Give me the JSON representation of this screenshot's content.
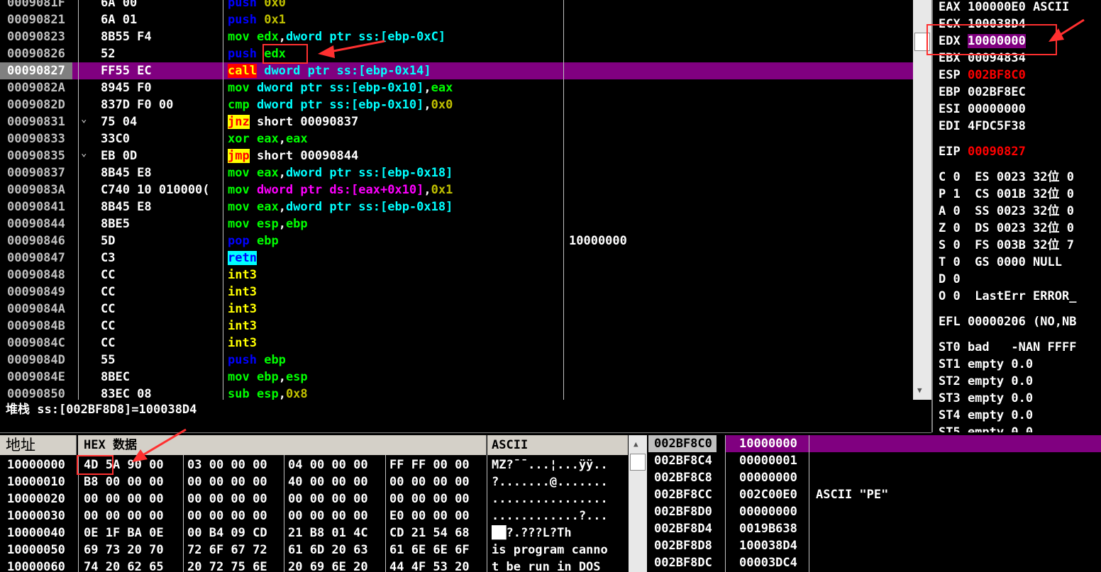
{
  "disasm": {
    "rows": [
      {
        "addr": "0009081F",
        "arrow": "",
        "hex": "6A 00",
        "parts": [
          [
            "push",
            "kw-blue"
          ],
          [
            " ",
            ""
          ],
          [
            "0x0",
            "kw-olive"
          ]
        ]
      },
      {
        "addr": "00090821",
        "arrow": "",
        "hex": "6A 01",
        "parts": [
          [
            "push",
            "kw-blue"
          ],
          [
            " ",
            ""
          ],
          [
            "0x1",
            "kw-olive"
          ]
        ]
      },
      {
        "addr": "00090823",
        "arrow": "",
        "hex": "8B55 F4",
        "parts": [
          [
            "mov",
            "kw-green"
          ],
          [
            " ",
            ""
          ],
          [
            "edx",
            "kw-green"
          ],
          [
            ",",
            ""
          ],
          [
            "dword ptr ss:[ebp-0xC]",
            "kw-cyan"
          ]
        ]
      },
      {
        "addr": "00090826",
        "arrow": "",
        "hex": "52",
        "parts": [
          [
            "push",
            "kw-blue"
          ],
          [
            " ",
            ""
          ],
          [
            "edx",
            "kw-green"
          ]
        ]
      },
      {
        "addr": "00090827",
        "arrow": "",
        "hex": "FF55 EC",
        "parts": [
          [
            "call",
            "kw-redbox"
          ],
          [
            " ",
            ""
          ],
          [
            "dword ptr ss:[ebp-0x14]",
            "kw-cyan"
          ]
        ],
        "selected": true
      },
      {
        "addr": "0009082A",
        "arrow": "",
        "hex": "8945 F0",
        "parts": [
          [
            "mov",
            "kw-green"
          ],
          [
            " ",
            ""
          ],
          [
            "dword ptr ss:[ebp-0x10]",
            "kw-cyan"
          ],
          [
            ",",
            ""
          ],
          [
            "eax",
            "kw-green"
          ]
        ]
      },
      {
        "addr": "0009082D",
        "arrow": "",
        "hex": "837D F0 00",
        "parts": [
          [
            "cmp",
            "kw-green"
          ],
          [
            " ",
            ""
          ],
          [
            "dword ptr ss:[ebp-0x10]",
            "kw-cyan"
          ],
          [
            ",",
            ""
          ],
          [
            "0x0",
            "kw-olive"
          ]
        ]
      },
      {
        "addr": "00090831",
        "arrow": "⌄",
        "hex": "75 04",
        "parts": [
          [
            "jnz",
            "kw-yellowbox"
          ],
          [
            " ",
            ""
          ],
          [
            "short 00090837",
            "white"
          ]
        ]
      },
      {
        "addr": "00090833",
        "arrow": "",
        "hex": "33C0",
        "parts": [
          [
            "xor",
            "kw-green"
          ],
          [
            " ",
            ""
          ],
          [
            "eax",
            "kw-green"
          ],
          [
            ",",
            ""
          ],
          [
            "eax",
            "kw-green"
          ]
        ]
      },
      {
        "addr": "00090835",
        "arrow": "⌄",
        "hex": "EB 0D",
        "parts": [
          [
            "jmp",
            "kw-yellowbox"
          ],
          [
            " ",
            ""
          ],
          [
            "short 00090844",
            "white"
          ]
        ]
      },
      {
        "addr": "00090837",
        "arrow": "",
        "hex": "8B45 E8",
        "parts": [
          [
            "mov",
            "kw-green"
          ],
          [
            " ",
            ""
          ],
          [
            "eax",
            "kw-green"
          ],
          [
            ",",
            ""
          ],
          [
            "dword ptr ss:[ebp-0x18]",
            "kw-cyan"
          ]
        ]
      },
      {
        "addr": "0009083A",
        "arrow": "",
        "hex": "C740 10 010000(",
        "parts": [
          [
            "mov",
            "kw-green"
          ],
          [
            " ",
            ""
          ],
          [
            "dword ptr ds:[eax+0x10]",
            "kw-mag"
          ],
          [
            ",",
            ""
          ],
          [
            "0x1",
            "kw-olive"
          ]
        ]
      },
      {
        "addr": "00090841",
        "arrow": "",
        "hex": "8B45 E8",
        "parts": [
          [
            "mov",
            "kw-green"
          ],
          [
            " ",
            ""
          ],
          [
            "eax",
            "kw-green"
          ],
          [
            ",",
            ""
          ],
          [
            "dword ptr ss:[ebp-0x18]",
            "kw-cyan"
          ]
        ]
      },
      {
        "addr": "00090844",
        "arrow": "",
        "hex": "8BE5",
        "parts": [
          [
            "mov",
            "kw-green"
          ],
          [
            " ",
            ""
          ],
          [
            "esp",
            "kw-green"
          ],
          [
            ",",
            ""
          ],
          [
            "ebp",
            "kw-green"
          ]
        ]
      },
      {
        "addr": "00090846",
        "arrow": "",
        "hex": "5D",
        "parts": [
          [
            "pop",
            "kw-blue"
          ],
          [
            " ",
            ""
          ],
          [
            "ebp",
            "kw-green"
          ]
        ],
        "comment": "10000000"
      },
      {
        "addr": "00090847",
        "arrow": "",
        "hex": "C3",
        "parts": [
          [
            "retn",
            "kw-cyanbox"
          ]
        ]
      },
      {
        "addr": "00090848",
        "arrow": "",
        "hex": "CC",
        "parts": [
          [
            "int3",
            "kw-yellow"
          ]
        ]
      },
      {
        "addr": "00090849",
        "arrow": "",
        "hex": "CC",
        "parts": [
          [
            "int3",
            "kw-yellow"
          ]
        ]
      },
      {
        "addr": "0009084A",
        "arrow": "",
        "hex": "CC",
        "parts": [
          [
            "int3",
            "kw-yellow"
          ]
        ]
      },
      {
        "addr": "0009084B",
        "arrow": "",
        "hex": "CC",
        "parts": [
          [
            "int3",
            "kw-yellow"
          ]
        ]
      },
      {
        "addr": "0009084C",
        "arrow": "",
        "hex": "CC",
        "parts": [
          [
            "int3",
            "kw-yellow"
          ]
        ]
      },
      {
        "addr": "0009084D",
        "arrow": "",
        "hex": "55",
        "parts": [
          [
            "push",
            "kw-blue"
          ],
          [
            " ",
            ""
          ],
          [
            "ebp",
            "kw-green"
          ]
        ]
      },
      {
        "addr": "0009084E",
        "arrow": "",
        "hex": "8BEC",
        "parts": [
          [
            "mov",
            "kw-green"
          ],
          [
            " ",
            ""
          ],
          [
            "ebp",
            "kw-green"
          ],
          [
            ",",
            ""
          ],
          [
            "esp",
            "kw-green"
          ]
        ]
      },
      {
        "addr": "00090850",
        "arrow": "",
        "hex": "83EC 08",
        "parts": [
          [
            "sub",
            "kw-green"
          ],
          [
            " ",
            ""
          ],
          [
            "esp",
            "kw-green"
          ],
          [
            ",",
            ""
          ],
          [
            "0x8",
            "kw-olive"
          ]
        ]
      }
    ]
  },
  "info_line": "堆栈 ss:[002BF8D8]=100038D4",
  "registers": {
    "rows": [
      {
        "parts": [
          [
            "EAX ",
            "white"
          ],
          [
            "100000E0 ASCII ",
            "white"
          ]
        ]
      },
      {
        "parts": [
          [
            "ECX ",
            "white"
          ],
          [
            "100038D4",
            "white"
          ]
        ]
      },
      {
        "parts": [
          [
            "EDX ",
            "white"
          ],
          [
            "10000000",
            "edxhl"
          ]
        ]
      },
      {
        "parts": [
          [
            "EBX ",
            "white"
          ],
          [
            "00094834",
            "white"
          ]
        ]
      },
      {
        "parts": [
          [
            "ESP ",
            "white"
          ],
          [
            "002BF8C0",
            "kw-red"
          ]
        ]
      },
      {
        "parts": [
          [
            "EBP ",
            "white"
          ],
          [
            "002BF8EC",
            "white"
          ]
        ]
      },
      {
        "parts": [
          [
            "ESI ",
            "white"
          ],
          [
            "00000000",
            "white"
          ]
        ]
      },
      {
        "parts": [
          [
            "EDI ",
            "white"
          ],
          [
            "4FDC5F38",
            "white"
          ]
        ]
      },
      {
        "parts": [
          [
            "EIP ",
            "white"
          ],
          [
            "00090827",
            "kw-red"
          ]
        ],
        "gap": true
      },
      {
        "parts": [
          [
            "C 0  ES 0023 32位 0",
            "white"
          ]
        ],
        "gap": true
      },
      {
        "parts": [
          [
            "P 1  CS 001B 32位 0",
            "white"
          ]
        ]
      },
      {
        "parts": [
          [
            "A 0  SS 0023 32位 0",
            "white"
          ]
        ]
      },
      {
        "parts": [
          [
            "Z 0  DS 0023 32位 0",
            "white"
          ]
        ]
      },
      {
        "parts": [
          [
            "S 0  FS 003B 32位 7",
            "white"
          ]
        ]
      },
      {
        "parts": [
          [
            "T 0  GS 0000 NULL",
            "white"
          ]
        ]
      },
      {
        "parts": [
          [
            "D 0",
            "white"
          ]
        ]
      },
      {
        "parts": [
          [
            "O 0  LastErr ERROR_",
            "white"
          ]
        ]
      },
      {
        "parts": [
          [
            "EFL 00000206 (NO,NB",
            "white"
          ]
        ],
        "gap": true
      },
      {
        "parts": [
          [
            "ST0 bad   -NAN FFFF",
            "white"
          ]
        ],
        "gap": true
      },
      {
        "parts": [
          [
            "ST1 empty 0.0",
            "white"
          ]
        ]
      },
      {
        "parts": [
          [
            "ST2 empty 0.0",
            "white"
          ]
        ]
      },
      {
        "parts": [
          [
            "ST3 empty 0.0",
            "white"
          ]
        ]
      },
      {
        "parts": [
          [
            "ST4 empty 0.0",
            "white"
          ]
        ]
      },
      {
        "parts": [
          [
            "ST5 empty 0.0",
            "white"
          ]
        ]
      }
    ]
  },
  "dump": {
    "header_addr": "地址",
    "header_hex": "HEX 数据",
    "header_ascii": "ASCII",
    "rows": [
      {
        "addr": "10000000",
        "g": [
          "4D 5A 90 00",
          "03 00 00 00",
          "04 00 00 00",
          "FF FF 00 00"
        ],
        "ascii": "MZ?¯¯...¦...ÿÿ.."
      },
      {
        "addr": "10000010",
        "g": [
          "B8 00 00 00",
          "00 00 00 00",
          "40 00 00 00",
          "00 00 00 00"
        ],
        "ascii": "?.......@......."
      },
      {
        "addr": "10000020",
        "g": [
          "00 00 00 00",
          "00 00 00 00",
          "00 00 00 00",
          "00 00 00 00"
        ],
        "ascii": "................"
      },
      {
        "addr": "10000030",
        "g": [
          "00 00 00 00",
          "00 00 00 00",
          "00 00 00 00",
          "E0 00 00 00"
        ],
        "ascii": "............?..."
      },
      {
        "addr": "10000040",
        "g": [
          "0E 1F BA 0E",
          "00 B4 09 CD",
          "21 B8 01 4C",
          "CD 21 54 68"
        ],
        "ascii": "██?.???L?Th"
      },
      {
        "addr": "10000050",
        "g": [
          "69 73 20 70",
          "72 6F 67 72",
          "61 6D 20 63",
          "61 6E 6E 6F"
        ],
        "ascii": "is program canno"
      },
      {
        "addr": "10000060",
        "g": [
          "74 20 62 65",
          "20 72 75 6E",
          "20 69 6E 20",
          "44 4F 53 20"
        ],
        "ascii": "t be run in DOS "
      }
    ]
  },
  "stack": {
    "rows": [
      {
        "addr": "002BF8C0",
        "val": "10000000",
        "comment": "",
        "selected": true
      },
      {
        "addr": "002BF8C4",
        "val": "00000001",
        "comment": ""
      },
      {
        "addr": "002BF8C8",
        "val": "00000000",
        "comment": ""
      },
      {
        "addr": "002BF8CC",
        "val": "002C00E0",
        "comment": "ASCII \"PE\""
      },
      {
        "addr": "002BF8D0",
        "val": "00000000",
        "comment": ""
      },
      {
        "addr": "002BF8D4",
        "val": "0019B638",
        "comment": ""
      },
      {
        "addr": "002BF8D8",
        "val": "100038D4",
        "comment": ""
      },
      {
        "addr": "002BF8DC",
        "val": "00003DC4",
        "comment": ""
      }
    ]
  },
  "colors": {
    "selection": "#800080",
    "annotation": "#ff3030"
  }
}
